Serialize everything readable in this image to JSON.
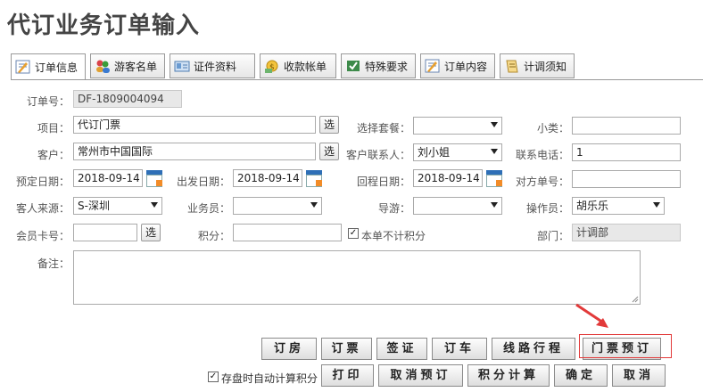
{
  "page": {
    "title": "代订业务订单输入"
  },
  "tabs": [
    {
      "label": "订单信息"
    },
    {
      "label": "游客名单"
    },
    {
      "label": "证件资料"
    },
    {
      "label": "收款帐单"
    },
    {
      "label": "特殊要求"
    },
    {
      "label": "订单内容"
    },
    {
      "label": "计调须知"
    }
  ],
  "form": {
    "order_no": {
      "label": "订单号：",
      "value": "DF-1809004094"
    },
    "project": {
      "label": "项目：",
      "value": "代订门票",
      "pick": "选"
    },
    "package": {
      "label": "选择套餐：",
      "value": ""
    },
    "subtype": {
      "label": "小类：",
      "value": ""
    },
    "customer": {
      "label": "客户：",
      "value": "常州市中国国际",
      "pick": "选"
    },
    "contact": {
      "label": "客户联系人：",
      "value": "刘小姐"
    },
    "phone": {
      "label": "联系电话：",
      "value": "1"
    },
    "book_date": {
      "label": "预定日期：",
      "value": "2018-09-14"
    },
    "depart_date": {
      "label": "出发日期：",
      "value": "2018-09-14"
    },
    "return_date": {
      "label": "回程日期：",
      "value": "2018-09-14"
    },
    "other_no": {
      "label": "对方单号：",
      "value": ""
    },
    "source": {
      "label": "客人来源：",
      "value": "S-深圳"
    },
    "salesman": {
      "label": "业务员：",
      "value": ""
    },
    "guide": {
      "label": "导游：",
      "value": ""
    },
    "operator": {
      "label": "操作员：",
      "value": "胡乐乐"
    },
    "member_card": {
      "label": "会员卡号：",
      "value": "",
      "pick": "选"
    },
    "points": {
      "label": "积分：",
      "value": ""
    },
    "no_points": {
      "label": "本单不计积分",
      "checked": true
    },
    "dept": {
      "label": "部门：",
      "value": "计调部"
    },
    "remark": {
      "label": "备注：",
      "value": ""
    }
  },
  "buttons_row1": [
    "订房",
    "订票",
    "签证",
    "订车",
    "线路行程",
    "门票预订"
  ],
  "auto_calc": {
    "label": "存盘时自动计算积分",
    "checked": true
  },
  "buttons_row2": [
    "打印",
    "取消预订",
    "积分计算",
    "确定",
    "取消"
  ],
  "colors": {
    "highlight": "#e23a3a",
    "arrow": "#e23a3a"
  }
}
